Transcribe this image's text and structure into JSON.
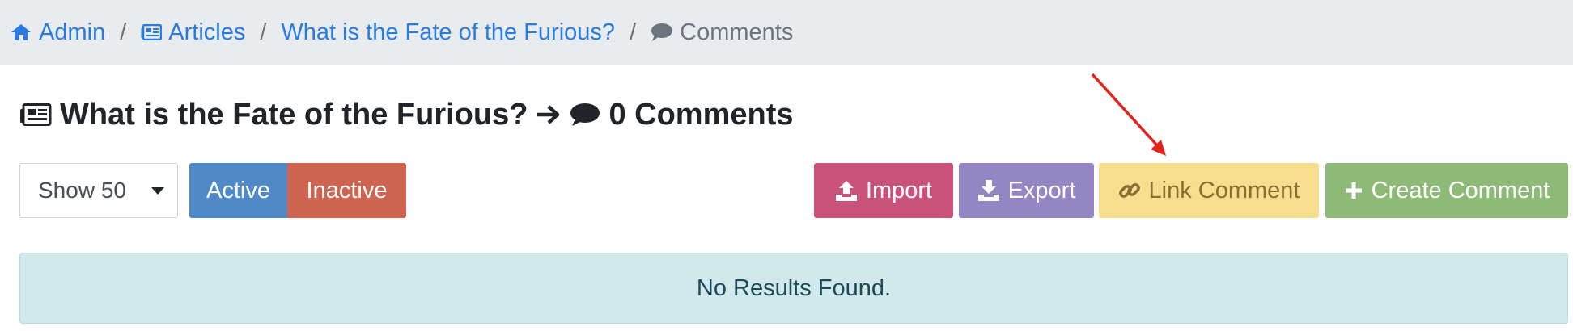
{
  "breadcrumb": {
    "admin": "Admin",
    "articles": "Articles",
    "article": "What is the Fate of the Furious?",
    "current": "Comments",
    "separator": "/"
  },
  "title": {
    "article": "What is the Fate of the Furious?",
    "comments": "0 Comments"
  },
  "toolbar": {
    "page_size": "Show 50",
    "active_label": "Active",
    "inactive_label": "Inactive",
    "import_label": "Import",
    "export_label": "Export",
    "link_label": "Link Comment",
    "create_label": "Create Comment"
  },
  "message": "No Results Found.",
  "colors": {
    "link": "#2a7ae4",
    "active": "#4f89c8",
    "inactive": "#cf6550",
    "import": "#c9527a",
    "export": "#9486c2",
    "link_comment": "#f7de8f",
    "create": "#8dbb77",
    "annotation_arrow": "#e3221b"
  },
  "icons": [
    "home-icon",
    "newspaper-icon",
    "comment-icon",
    "arrow-right-icon",
    "upload-icon",
    "download-icon",
    "link-icon",
    "plus-icon"
  ]
}
